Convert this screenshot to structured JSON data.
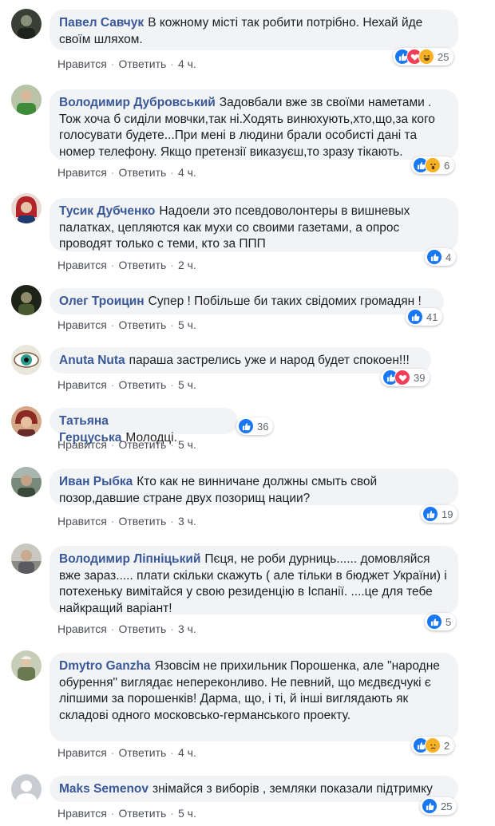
{
  "actions": {
    "like": "Нравится",
    "reply": "Ответить",
    "separator": "·"
  },
  "comments": [
    {
      "author": "Павел Савчук",
      "text": "В кожному місті так робити потрібно. Нехай йде своїм шляхом.",
      "time": "4 ч.",
      "reactions": [
        "like",
        "love",
        "haha"
      ],
      "count": "25"
    },
    {
      "author": "Володимир Дубровський",
      "text": "Задовбали вже зв своїми наметами . Тож хоча б сиділи мовчки,так ні.Ходять винюхують,хто,що,за кого голосувати будете...При мені в людини брали особисті дані та номер телефону. Якщо претензії виказуєш,то зразу тікають.",
      "time": "4 ч.",
      "reactions": [
        "like",
        "wow"
      ],
      "count": "6"
    },
    {
      "author": "Тусик Дубченко",
      "text": "Надоели это псевдоволонтеры в вишневых палатках, цепляются как мухи со своими газетами, а опрос проводят только с теми, кто за ППП",
      "time": "2 ч.",
      "reactions": [
        "like"
      ],
      "count": "4"
    },
    {
      "author": "Олег Троицин",
      "text": "Супер ! Побільше би таких свідомих громадян !",
      "time": "5 ч.",
      "reactions": [
        "like"
      ],
      "count": "41"
    },
    {
      "author": "Anuta Nuta",
      "text": "параша застрелись уже и народ будет спокоен!!!",
      "time": "5 ч.",
      "reactions": [
        "like",
        "love"
      ],
      "count": "39"
    },
    {
      "author": "Татьяна Герцуська",
      "text": "Молодці.",
      "time": "5 ч.",
      "reactions": [
        "like"
      ],
      "count": "36"
    },
    {
      "author": "Иван Рыбка",
      "text": "Кто как не винничане должны смыть свой позор,давшие стране двух позорищ нации?",
      "time": "3 ч.",
      "reactions": [
        "like"
      ],
      "count": "19"
    },
    {
      "author": "Володимир Ліпніцький",
      "text": "Пєця, не роби дурниць...... домовляйся вже зараз..... плати скільки скажуть ( але тільки в бюджет України) і потехеньку вимітайся у свою резиденцію в Іспанії. ....це для тебе найкращий варіант!",
      "time": "3 ч.",
      "reactions": [
        "like"
      ],
      "count": "5"
    },
    {
      "author": "Dmytro Ganzha",
      "text": "Язовсім не прихильник Порошенка, але \"народне обурення\" виглядає непереконливо. Не певний, що мєдвєдчукі є ліпшими за порошенків! Дарма, що, і ті, й інші виглядають як складові одного московсько-германського проекту.",
      "time": "4 ч.",
      "reactions": [
        "like",
        "sad"
      ],
      "count": "2"
    },
    {
      "author": "Maks Semenov",
      "text": "знімайся з виборів , земляки показали підтримку",
      "time": "5 ч.",
      "reactions": [
        "like"
      ],
      "count": "25"
    }
  ]
}
